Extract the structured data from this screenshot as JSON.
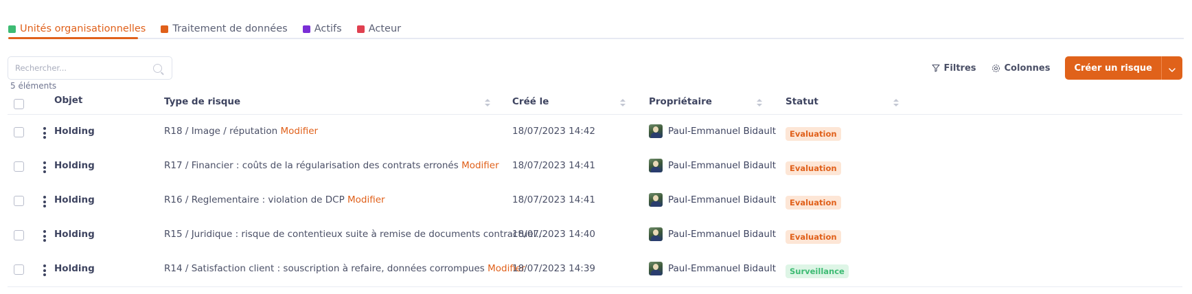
{
  "tabs": [
    {
      "label": "Unités organisationnelles",
      "icon": "building-icon",
      "color": "#3dbb73",
      "active": true
    },
    {
      "label": "Traitement de données",
      "icon": "document-icon",
      "color": "#e0601a",
      "active": false
    },
    {
      "label": "Actifs",
      "icon": "monitor-icon",
      "color": "#7a2ed6",
      "active": false
    },
    {
      "label": "Acteur",
      "icon": "org-chart-icon",
      "color": "#e04050",
      "active": false
    }
  ],
  "search": {
    "placeholder": "Rechercher..."
  },
  "count_label": "5 éléments",
  "toolbar": {
    "filters_label": "Filtres",
    "columns_label": "Colonnes",
    "create_label": "Créer un risque"
  },
  "table": {
    "columns": [
      "Objet",
      "Type de risque",
      "Créé le",
      "Propriétaire",
      "Statut"
    ],
    "rows": [
      {
        "objet": "Holding",
        "type": "R18 / Image / réputation",
        "modify": "Modifier",
        "created": "18/07/2023 14:42",
        "owner": "Paul-Emmanuel Bidault",
        "status": "Evaluation",
        "status_kind": "eval"
      },
      {
        "objet": "Holding",
        "type": "R17 / Financier : coûts de la régularisation des contrats erronés",
        "modify": "Modifier",
        "created": "18/07/2023 14:41",
        "owner": "Paul-Emmanuel Bidault",
        "status": "Evaluation",
        "status_kind": "eval"
      },
      {
        "objet": "Holding",
        "type": "R16 / Reglementaire : violation de DCP",
        "modify": "Modifier",
        "created": "18/07/2023 14:41",
        "owner": "Paul-Emmanuel Bidault",
        "status": "Evaluation",
        "status_kind": "eval"
      },
      {
        "objet": "Holding",
        "type": "R15 / Juridique : risque de contentieux suite à remise de documents contractuel...",
        "modify": "",
        "created": "18/07/2023 14:40",
        "owner": "Paul-Emmanuel Bidault",
        "status": "Evaluation",
        "status_kind": "eval"
      },
      {
        "objet": "Holding",
        "type": "R14 / Satisfaction client : souscription à refaire, données corrompues",
        "modify": "Modifier",
        "created": "18/07/2023 14:39",
        "owner": "Paul-Emmanuel Bidault",
        "status": "Surveillance",
        "status_kind": "surv"
      }
    ]
  }
}
